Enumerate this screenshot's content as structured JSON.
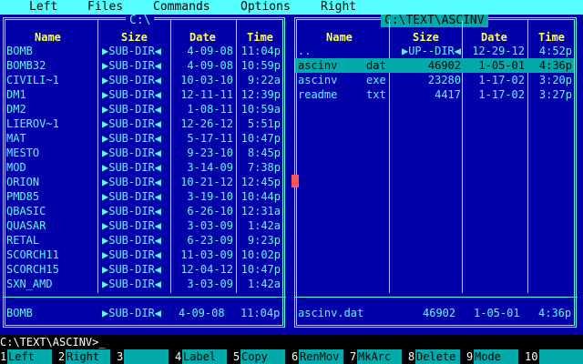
{
  "menu": [
    "Left",
    "Files",
    "Commands",
    "Options",
    "Right"
  ],
  "left_panel": {
    "path": "C:\\",
    "headers": {
      "name": "Name",
      "size": "Size",
      "date": "Date",
      "time": "Time"
    },
    "rows": [
      {
        "name": "BOMB",
        "ext": "",
        "size": "▶SUB-DIR◀",
        "date": "4-09-08",
        "time": "11:04p"
      },
      {
        "name": "BOMB32",
        "ext": "",
        "size": "▶SUB-DIR◀",
        "date": "4-09-08",
        "time": "10:59p"
      },
      {
        "name": "CIVILI~1",
        "ext": "",
        "size": "▶SUB-DIR◀",
        "date": "10-03-10",
        "time": "9:22a"
      },
      {
        "name": "DM1",
        "ext": "",
        "size": "▶SUB-DIR◀",
        "date": "12-11-11",
        "time": "12:39p"
      },
      {
        "name": "DM2",
        "ext": "",
        "size": "▶SUB-DIR◀",
        "date": "1-08-11",
        "time": "10:59a"
      },
      {
        "name": "LIEROV~1",
        "ext": "",
        "size": "▶SUB-DIR◀",
        "date": "12-26-12",
        "time": "5:51p"
      },
      {
        "name": "MAT",
        "ext": "",
        "size": "▶SUB-DIR◀",
        "date": "5-17-11",
        "time": "10:47p"
      },
      {
        "name": "MESTO",
        "ext": "",
        "size": "▶SUB-DIR◀",
        "date": "9-23-10",
        "time": "8:45p"
      },
      {
        "name": "MOD",
        "ext": "",
        "size": "▶SUB-DIR◀",
        "date": "3-14-09",
        "time": "7:38p"
      },
      {
        "name": "ORION",
        "ext": "",
        "size": "▶SUB-DIR◀",
        "date": "10-21-12",
        "time": "12:45p"
      },
      {
        "name": "PMD85",
        "ext": "",
        "size": "▶SUB-DIR◀",
        "date": "3-19-10",
        "time": "10:44p"
      },
      {
        "name": "QBASIC",
        "ext": "",
        "size": "▶SUB-DIR◀",
        "date": "6-26-10",
        "time": "12:31a"
      },
      {
        "name": "QUASAR",
        "ext": "",
        "size": "▶SUB-DIR◀",
        "date": "3-03-09",
        "time": "1:42a"
      },
      {
        "name": "RETAL",
        "ext": "",
        "size": "▶SUB-DIR◀",
        "date": "6-23-09",
        "time": "9:23p"
      },
      {
        "name": "SCORCH11",
        "ext": "",
        "size": "▶SUB-DIR◀",
        "date": "11-03-09",
        "time": "10:02p"
      },
      {
        "name": "SCORCH15",
        "ext": "",
        "size": "▶SUB-DIR◀",
        "date": "12-04-12",
        "time": "10:47p"
      },
      {
        "name": "SXN_AMD",
        "ext": "",
        "size": "▶SUB-DIR◀",
        "date": "3-03-09",
        "time": "1:42a"
      }
    ],
    "status": {
      "name": "BOMB",
      "size": "▶SUB-DIR◀",
      "date": "4-09-08",
      "time": "11:04p"
    }
  },
  "right_panel": {
    "path": "C:\\TEXT\\ASCINV",
    "headers": {
      "name": "Name",
      "size": "Size",
      "date": "Date",
      "time": "Time"
    },
    "rows": [
      {
        "name": "..",
        "ext": "",
        "size": "▶UP--DIR◀",
        "date": "12-29-12",
        "time": "4:52p"
      },
      {
        "name": "ascinv",
        "ext": "dat",
        "size": "46902",
        "date": "1-05-01",
        "time": "4:36p"
      },
      {
        "name": "ascinv",
        "ext": "exe",
        "size": "23280",
        "date": "1-17-02",
        "time": "3:20p"
      },
      {
        "name": "readme",
        "ext": "txt",
        "size": "4417",
        "date": "1-17-02",
        "time": "3:27p"
      }
    ],
    "selected_index": 1,
    "status": {
      "name": "ascinv.dat",
      "size": "46902",
      "date": "1-05-01",
      "time": "4:36p"
    }
  },
  "command_line": "C:\\TEXT\\ASCINV>_",
  "fkeys": [
    {
      "num": "1",
      "label": "Left"
    },
    {
      "num": "2",
      "label": "Right"
    },
    {
      "num": "3",
      "label": ""
    },
    {
      "num": "4",
      "label": "Label"
    },
    {
      "num": "5",
      "label": "Copy"
    },
    {
      "num": "6",
      "label": "RenMov"
    },
    {
      "num": "7",
      "label": "MkArc"
    },
    {
      "num": "8",
      "label": "Delete"
    },
    {
      "num": "9",
      "label": "Mode"
    },
    {
      "num": "10",
      "label": ""
    }
  ],
  "colors": {
    "background": "#0000a8",
    "frame": "#55ffff",
    "header_text": "#ffff55",
    "selection": "#00aaaa"
  }
}
